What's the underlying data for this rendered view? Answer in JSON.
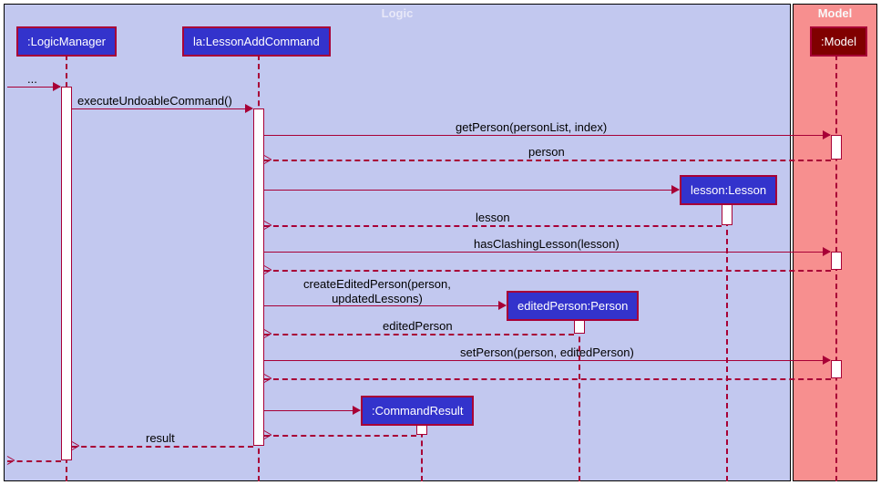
{
  "frames": {
    "logic": "Logic",
    "model": "Model"
  },
  "participants": {
    "logicManager": ":LogicManager",
    "lessonAdd": "la:LessonAddCommand",
    "model": ":Model",
    "lesson": "lesson:Lesson",
    "editedPerson": "editedPerson:Person",
    "commandResult": ":CommandResult"
  },
  "messages": {
    "incoming": "...",
    "execute": "executeUndoableCommand()",
    "getPerson": "getPerson(personList, index)",
    "personReturn": "person",
    "lessonReturn": "lesson",
    "hasClashing": "hasClashingLesson(lesson)",
    "createEdited": "createEditedPerson(person,\nupdatedLessons)",
    "editedReturn": "editedPerson",
    "setPerson": "setPerson(person, editedPerson)",
    "result": "result"
  }
}
